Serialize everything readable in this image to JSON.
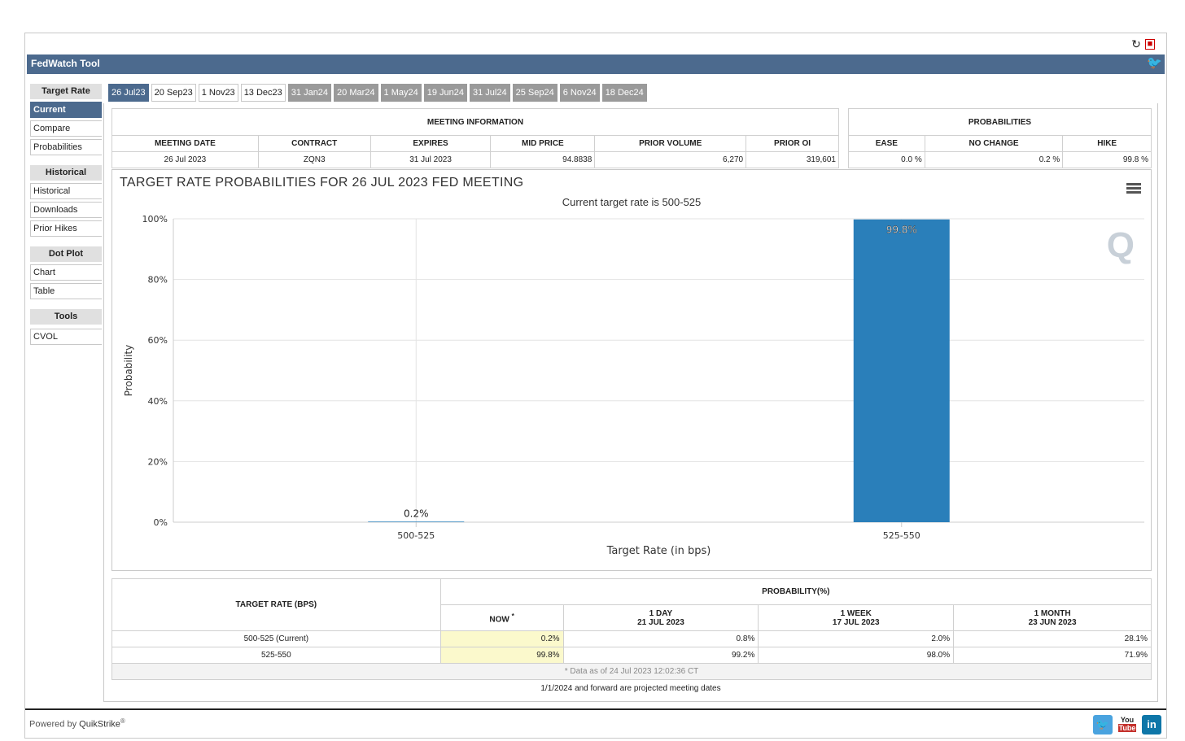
{
  "app": {
    "title": "FedWatch Tool"
  },
  "sidebar": {
    "groups": [
      {
        "head": "Target Rate",
        "items": [
          "Current",
          "Compare",
          "Probabilities"
        ]
      },
      {
        "head": "Historical",
        "items": [
          "Historical",
          "Downloads",
          "Prior Hikes"
        ]
      },
      {
        "head": "Dot Plot",
        "items": [
          "Chart",
          "Table"
        ]
      },
      {
        "head": "Tools",
        "items": [
          "CVOL"
        ]
      }
    ]
  },
  "tabs": [
    "26 Jul23",
    "20 Sep23",
    "1 Nov23",
    "13 Dec23",
    "31 Jan24",
    "20 Mar24",
    "1 May24",
    "19 Jun24",
    "31 Jul24",
    "25 Sep24",
    "6 Nov24",
    "18 Dec24"
  ],
  "meeting_info": {
    "caption": "MEETING INFORMATION",
    "headers": [
      "MEETING DATE",
      "CONTRACT",
      "EXPIRES",
      "MID PRICE",
      "PRIOR VOLUME",
      "PRIOR OI"
    ],
    "values": [
      "26 Jul 2023",
      "ZQN3",
      "31 Jul 2023",
      "94.8838",
      "6,270",
      "319,601"
    ]
  },
  "probabilities": {
    "caption": "PROBABILITIES",
    "headers": [
      "EASE",
      "NO CHANGE",
      "HIKE"
    ],
    "values": [
      "0.0 %",
      "0.2 %",
      "99.8 %"
    ]
  },
  "chart": {
    "title": "TARGET RATE PROBABILITIES FOR 26 JUL 2023 FED MEETING",
    "subtitle": "Current target rate is 500-525",
    "watermark": "Q"
  },
  "chart_data": {
    "type": "bar",
    "title": "TARGET RATE PROBABILITIES FOR 26 JUL 2023 FED MEETING",
    "subtitle": "Current target rate is 500-525",
    "categories": [
      "500-525",
      "525-550"
    ],
    "values": [
      0.2,
      99.8
    ],
    "data_labels": [
      "0.2%",
      "99.8%"
    ],
    "xlabel": "Target Rate (in bps)",
    "ylabel": "Probability",
    "ylim": [
      0,
      100
    ],
    "yticks": [
      "0%",
      "20%",
      "40%",
      "60%",
      "80%",
      "100%"
    ],
    "bar_color": "#2a7fba",
    "grid": true
  },
  "bottom_table": {
    "col1_header": "TARGET RATE (BPS)",
    "group_header": "PROBABILITY(%)",
    "now_header": "NOW",
    "now_mark": "*",
    "day": {
      "label": "1 DAY",
      "date": "21 JUL 2023"
    },
    "week": {
      "label": "1 WEEK",
      "date": "17 JUL 2023"
    },
    "month": {
      "label": "1 MONTH",
      "date": "23 JUN 2023"
    },
    "rows": [
      {
        "rate": "500-525 (Current)",
        "now": "0.2%",
        "day": "0.8%",
        "week": "2.0%",
        "month": "28.1%"
      },
      {
        "rate": "525-550",
        "now": "99.8%",
        "day": "99.2%",
        "week": "98.0%",
        "month": "71.9%"
      }
    ],
    "footnote": "* Data as of 24 Jul 2023 12:02:36 CT"
  },
  "projected_note": "1/1/2024 and forward are projected meeting dates",
  "footer": {
    "powered_prefix": "Powered by",
    "brand": "QuikStrike",
    "reg": "®"
  },
  "social": {
    "youtube_top": "You",
    "youtube_bottom": "Tube",
    "linkedin": "in"
  },
  "colors": {
    "header_bg": "#4c6a8e",
    "active_tab": "#4c6a8e",
    "future_tab": "#9a9a9a",
    "bar": "#2a7fba",
    "highlight": "#fbf9cc"
  }
}
